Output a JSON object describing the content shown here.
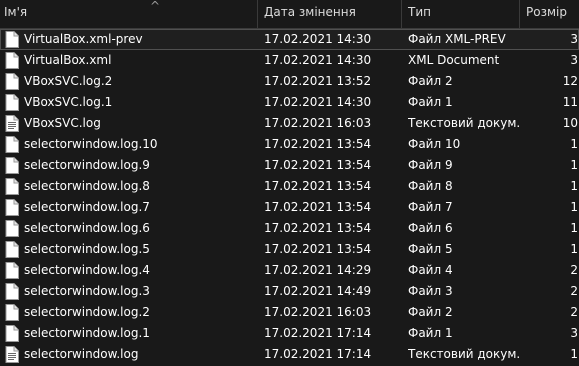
{
  "columns": {
    "name": "Ім'я",
    "date": "Дата змінення",
    "type": "Тип",
    "size": "Розмір"
  },
  "sort_indicator": "^",
  "files": [
    {
      "name": "VirtualBox.xml-prev",
      "date": "17.02.2021 14:30",
      "type": "Файл XML-PREV",
      "size": "3",
      "icon": "document-icon",
      "selected": true
    },
    {
      "name": "VirtualBox.xml",
      "date": "17.02.2021 14:30",
      "type": "XML Document",
      "size": "3",
      "icon": "document-icon",
      "selected": false
    },
    {
      "name": "VBoxSVC.log.2",
      "date": "17.02.2021 13:52",
      "type": "Файл 2",
      "size": "12",
      "icon": "document-icon",
      "selected": false
    },
    {
      "name": "VBoxSVC.log.1",
      "date": "17.02.2021 14:30",
      "type": "Файл 1",
      "size": "11",
      "icon": "document-icon",
      "selected": false
    },
    {
      "name": "VBoxSVC.log",
      "date": "17.02.2021 16:03",
      "type": "Текстовий докум...",
      "size": "10",
      "icon": "text-document-icon",
      "selected": false
    },
    {
      "name": "selectorwindow.log.10",
      "date": "17.02.2021 13:54",
      "type": "Файл 10",
      "size": "1",
      "icon": "document-icon",
      "selected": false
    },
    {
      "name": "selectorwindow.log.9",
      "date": "17.02.2021 13:54",
      "type": "Файл 9",
      "size": "1",
      "icon": "document-icon",
      "selected": false
    },
    {
      "name": "selectorwindow.log.8",
      "date": "17.02.2021 13:54",
      "type": "Файл 8",
      "size": "1",
      "icon": "document-icon",
      "selected": false
    },
    {
      "name": "selectorwindow.log.7",
      "date": "17.02.2021 13:54",
      "type": "Файл 7",
      "size": "1",
      "icon": "document-icon",
      "selected": false
    },
    {
      "name": "selectorwindow.log.6",
      "date": "17.02.2021 13:54",
      "type": "Файл 6",
      "size": "1",
      "icon": "document-icon",
      "selected": false
    },
    {
      "name": "selectorwindow.log.5",
      "date": "17.02.2021 13:54",
      "type": "Файл 5",
      "size": "1",
      "icon": "document-icon",
      "selected": false
    },
    {
      "name": "selectorwindow.log.4",
      "date": "17.02.2021 14:29",
      "type": "Файл 4",
      "size": "2",
      "icon": "document-icon",
      "selected": false
    },
    {
      "name": "selectorwindow.log.3",
      "date": "17.02.2021 14:49",
      "type": "Файл 3",
      "size": "2",
      "icon": "document-icon",
      "selected": false
    },
    {
      "name": "selectorwindow.log.2",
      "date": "17.02.2021 16:03",
      "type": "Файл 2",
      "size": "2",
      "icon": "document-icon",
      "selected": false
    },
    {
      "name": "selectorwindow.log.1",
      "date": "17.02.2021 17:14",
      "type": "Файл 1",
      "size": "3",
      "icon": "document-icon",
      "selected": false
    },
    {
      "name": "selectorwindow.log",
      "date": "17.02.2021 17:14",
      "type": "Текстовий докум...",
      "size": "1",
      "icon": "text-document-icon",
      "selected": false
    }
  ]
}
